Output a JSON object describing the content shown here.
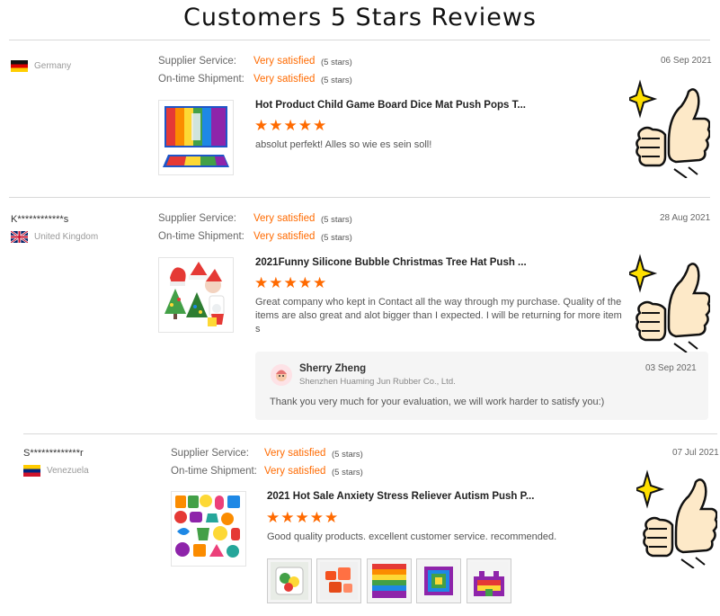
{
  "page_title": "Customers 5 Stars Reviews",
  "labels": {
    "supplier_service": "Supplier Service:",
    "ontime_shipment": "On-time Shipment:"
  },
  "rating_glyphs": "★★★★★",
  "reviews": [
    {
      "buyer": "",
      "country": "Germany",
      "supplier_value": "Very satisfied",
      "supplier_stars": "(5 stars)",
      "shipment_value": "Very satisfied",
      "shipment_stars": "(5 stars)",
      "date": "06 Sep 2021",
      "product_title": "Hot Product Child Game Board Dice Mat Push Pops T...",
      "text": "absolut perfekt! Alles so wie es sein soll!"
    },
    {
      "buyer": "K************s",
      "country": "United Kingdom",
      "supplier_value": "Very satisfied",
      "supplier_stars": "(5 stars)",
      "shipment_value": "Very satisfied",
      "shipment_stars": "(5 stars)",
      "date": "28 Aug 2021",
      "product_title": "2021Funny Silicone Bubble Christmas Tree Hat Push ...",
      "text": "Great company who kept in Contact all the way through my purchase. Quality of the items are also great and alot bigger than I expected. I will be returning for more items",
      "reply": {
        "name": "Sherry Zheng",
        "company": "Shenzhen Huaming Jun Rubber Co., Ltd.",
        "date": "03 Sep 2021",
        "text": "Thank you very much for your evaluation, we will work harder to satisfy you:)"
      }
    },
    {
      "buyer": "S*************r",
      "country": "Venezuela",
      "supplier_value": "Very satisfied",
      "supplier_stars": "(5 stars)",
      "shipment_value": "Very satisfied",
      "shipment_stars": "(5 stars)",
      "date": "07 Jul 2021",
      "product_title": "2021 Hot Sale Anxiety Stress Reliever Autism Push P...",
      "text": "Good quality products. excellent customer service. recommended."
    }
  ],
  "colors": {
    "accent": "#ff6a00",
    "divider": "#d9d9d9",
    "reply_bg": "#f5f5f5"
  },
  "icons": {
    "thumbs_up": "thumbs-up-sparkle-icon",
    "star": "star-icon"
  }
}
